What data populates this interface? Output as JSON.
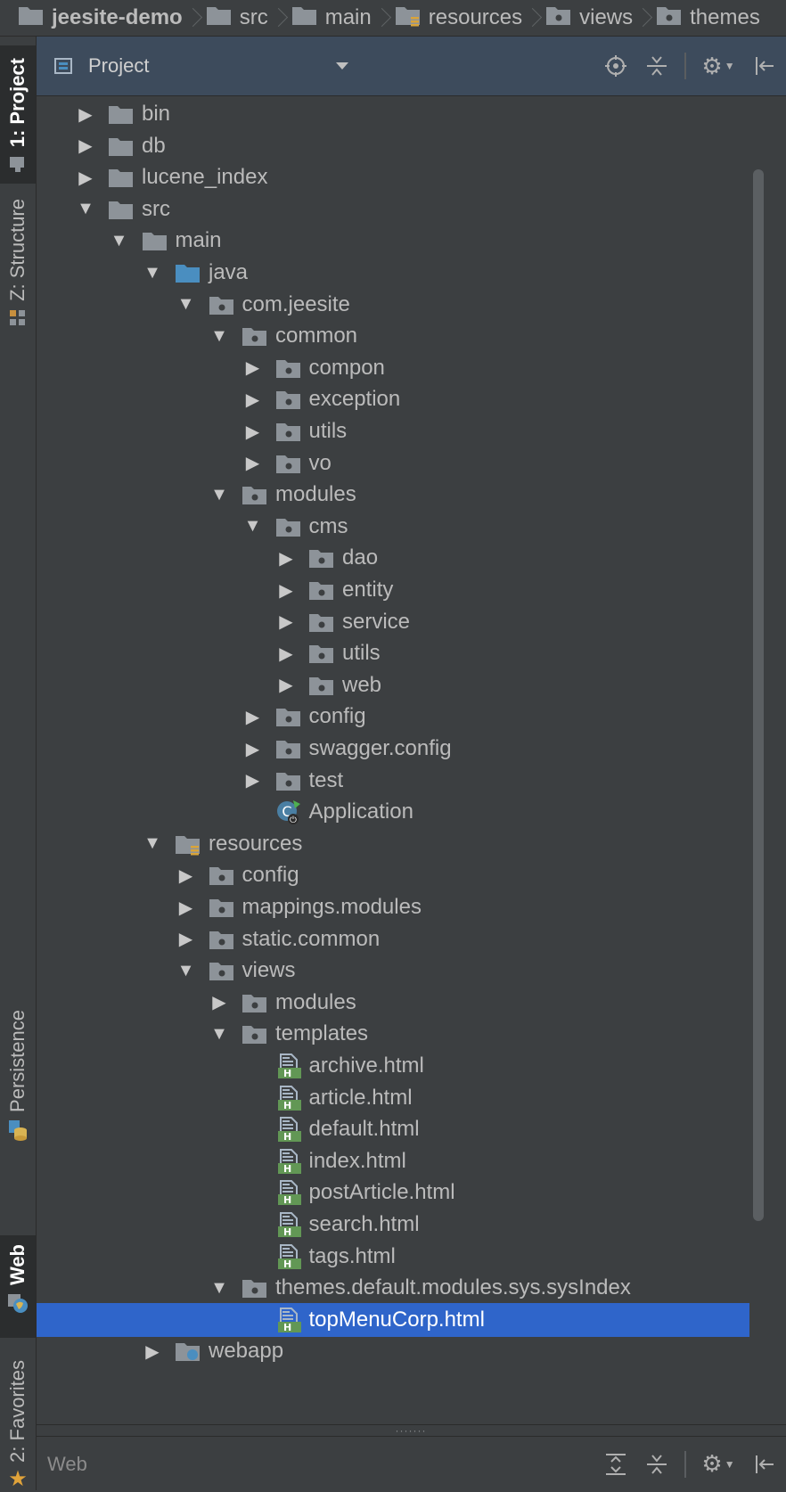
{
  "breadcrumb": {
    "items": [
      {
        "label": "jeesite-demo",
        "icon": "module-folder-icon"
      },
      {
        "label": "src",
        "icon": "folder-icon"
      },
      {
        "label": "main",
        "icon": "folder-icon"
      },
      {
        "label": "resources",
        "icon": "resources-folder-icon"
      },
      {
        "label": "views",
        "icon": "package-folder-icon"
      },
      {
        "label": "themes",
        "icon": "package-folder-icon"
      }
    ]
  },
  "left_strip": {
    "tabs": [
      {
        "label": "1: Project"
      },
      {
        "label": "Z: Structure"
      },
      {
        "label": "Persistence"
      },
      {
        "label": "Web"
      },
      {
        "label": "2: Favorites"
      }
    ]
  },
  "panel": {
    "title": "Project",
    "tools": [
      "locate-icon",
      "collapse-all-icon",
      "gear-icon",
      "hide-icon"
    ]
  },
  "tree": {
    "rows": [
      {
        "label": "bin",
        "depth": 0,
        "arrow": "collapsed",
        "icon": "folder"
      },
      {
        "label": "db",
        "depth": 0,
        "arrow": "collapsed",
        "icon": "folder"
      },
      {
        "label": "lucene_index",
        "depth": 0,
        "arrow": "collapsed",
        "icon": "folder"
      },
      {
        "label": "src",
        "depth": 0,
        "arrow": "expanded",
        "icon": "folder"
      },
      {
        "label": "main",
        "depth": 1,
        "arrow": "expanded",
        "icon": "folder"
      },
      {
        "label": "java",
        "depth": 2,
        "arrow": "expanded",
        "icon": "source-folder"
      },
      {
        "label": "com.jeesite",
        "depth": 3,
        "arrow": "expanded",
        "icon": "package"
      },
      {
        "label": "common",
        "depth": 4,
        "arrow": "expanded",
        "icon": "package"
      },
      {
        "label": "compon",
        "depth": 5,
        "arrow": "collapsed",
        "icon": "package"
      },
      {
        "label": "exception",
        "depth": 5,
        "arrow": "collapsed",
        "icon": "package"
      },
      {
        "label": "utils",
        "depth": 5,
        "arrow": "collapsed",
        "icon": "package"
      },
      {
        "label": "vo",
        "depth": 5,
        "arrow": "collapsed",
        "icon": "package"
      },
      {
        "label": "modules",
        "depth": 4,
        "arrow": "expanded",
        "icon": "package"
      },
      {
        "label": "cms",
        "depth": 5,
        "arrow": "expanded",
        "icon": "package"
      },
      {
        "label": "dao",
        "depth": 6,
        "arrow": "collapsed",
        "icon": "package"
      },
      {
        "label": "entity",
        "depth": 6,
        "arrow": "collapsed",
        "icon": "package"
      },
      {
        "label": "service",
        "depth": 6,
        "arrow": "collapsed",
        "icon": "package"
      },
      {
        "label": "utils",
        "depth": 6,
        "arrow": "collapsed",
        "icon": "package"
      },
      {
        "label": "web",
        "depth": 6,
        "arrow": "collapsed",
        "icon": "package"
      },
      {
        "label": "config",
        "depth": 5,
        "arrow": "collapsed",
        "icon": "package"
      },
      {
        "label": "swagger.config",
        "depth": 5,
        "arrow": "collapsed",
        "icon": "package"
      },
      {
        "label": "test",
        "depth": 5,
        "arrow": "collapsed",
        "icon": "package"
      },
      {
        "label": "Application",
        "depth": 5,
        "arrow": "none",
        "icon": "spring-app"
      },
      {
        "label": "resources",
        "depth": 2,
        "arrow": "expanded",
        "icon": "resources-folder"
      },
      {
        "label": "config",
        "depth": 3,
        "arrow": "collapsed",
        "icon": "package"
      },
      {
        "label": "mappings.modules",
        "depth": 3,
        "arrow": "collapsed",
        "icon": "package"
      },
      {
        "label": "static.common",
        "depth": 3,
        "arrow": "collapsed",
        "icon": "package"
      },
      {
        "label": "views",
        "depth": 3,
        "arrow": "expanded",
        "icon": "package"
      },
      {
        "label": "modules",
        "depth": 4,
        "arrow": "collapsed",
        "icon": "package"
      },
      {
        "label": "templates",
        "depth": 4,
        "arrow": "expanded",
        "icon": "package"
      },
      {
        "label": "archive.html",
        "depth": 5,
        "arrow": "none",
        "icon": "html-file"
      },
      {
        "label": "article.html",
        "depth": 5,
        "arrow": "none",
        "icon": "html-file"
      },
      {
        "label": "default.html",
        "depth": 5,
        "arrow": "none",
        "icon": "html-file"
      },
      {
        "label": "index.html",
        "depth": 5,
        "arrow": "none",
        "icon": "html-file"
      },
      {
        "label": "postArticle.html",
        "depth": 5,
        "arrow": "none",
        "icon": "html-file"
      },
      {
        "label": "search.html",
        "depth": 5,
        "arrow": "none",
        "icon": "html-file"
      },
      {
        "label": "tags.html",
        "depth": 5,
        "arrow": "none",
        "icon": "html-file"
      },
      {
        "label": "themes.default.modules.sys.sysIndex",
        "depth": 4,
        "arrow": "expanded",
        "icon": "package"
      },
      {
        "label": "topMenuCorp.html",
        "depth": 5,
        "arrow": "none",
        "icon": "html-file",
        "selected": true
      },
      {
        "label": "webapp",
        "depth": 2,
        "arrow": "collapsed",
        "icon": "web-folder"
      }
    ]
  },
  "bottom": {
    "title": "Web",
    "tools": [
      "expand-all-icon",
      "collapse-all-icon",
      "gear-icon",
      "hide-icon"
    ]
  },
  "colors": {
    "background": "#3c3f41",
    "header": "#3d4b5c",
    "selection": "#2f65ca",
    "folder": "#8d9399",
    "source_folder": "#4a8ec0",
    "html_badge": "#629755"
  }
}
